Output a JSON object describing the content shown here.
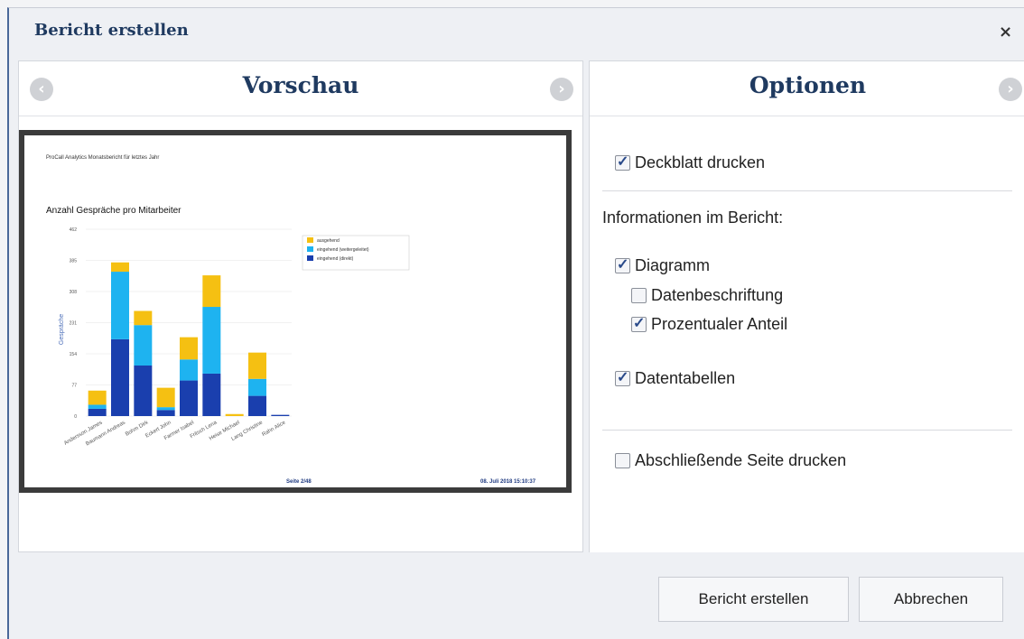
{
  "dialog": {
    "title": "Bericht erstellen",
    "close_symbol": "×"
  },
  "preview": {
    "title": "Vorschau",
    "page_header": "ProCall Analytics Monatsbericht für letztes Jahr",
    "footer_page": "Seite 2/48",
    "footer_date": "08. Juli 2018 15:10:37"
  },
  "options": {
    "title": "Optionen",
    "cover": {
      "label": "Deckblatt drucken",
      "checked": true
    },
    "info_heading": "Informationen im Bericht:",
    "diagram": {
      "label": "Diagramm",
      "checked": true
    },
    "data_labels": {
      "label": "Datenbeschriftung",
      "checked": false
    },
    "percentage": {
      "label": "Prozentualer Anteil",
      "checked": true
    },
    "tables": {
      "label": "Datentabellen",
      "checked": true
    },
    "closing": {
      "label": "Abschließende Seite drucken",
      "checked": false
    }
  },
  "footer": {
    "create_label": "Bericht erstellen",
    "cancel_label": "Abbrechen"
  },
  "colors": {
    "outgoing": "#f5c012",
    "forwarded": "#1eb3f0",
    "direct": "#1a3fae",
    "title": "#1f3a60"
  },
  "chart_data": {
    "type": "bar",
    "stacked": true,
    "title": "Anzahl Gespräche pro Mitarbeiter",
    "ylabel": "Gespräche",
    "ylim": [
      0,
      462
    ],
    "yticks": [
      "462",
      "385",
      "308",
      "231",
      "154",
      "77",
      "0"
    ],
    "categories": [
      "Andersson James",
      "Baumann Andreas",
      "Bohm Dirk",
      "Eckert John",
      "Farmer Isabel",
      "Fritsch Lena",
      "Heise Michael",
      "Lang Christine",
      "Rahn Alice"
    ],
    "series": [
      {
        "name": "eingehend (direkt)",
        "values": [
          18,
          190,
          125,
          15,
          88,
          105,
          0,
          50,
          3
        ]
      },
      {
        "name": "eingehend (weitergeleitet)",
        "values": [
          10,
          167,
          100,
          7,
          52,
          165,
          0,
          42,
          0
        ]
      },
      {
        "name": "ausgehend",
        "values": [
          35,
          23,
          35,
          48,
          55,
          78,
          5,
          65,
          0
        ]
      }
    ]
  }
}
